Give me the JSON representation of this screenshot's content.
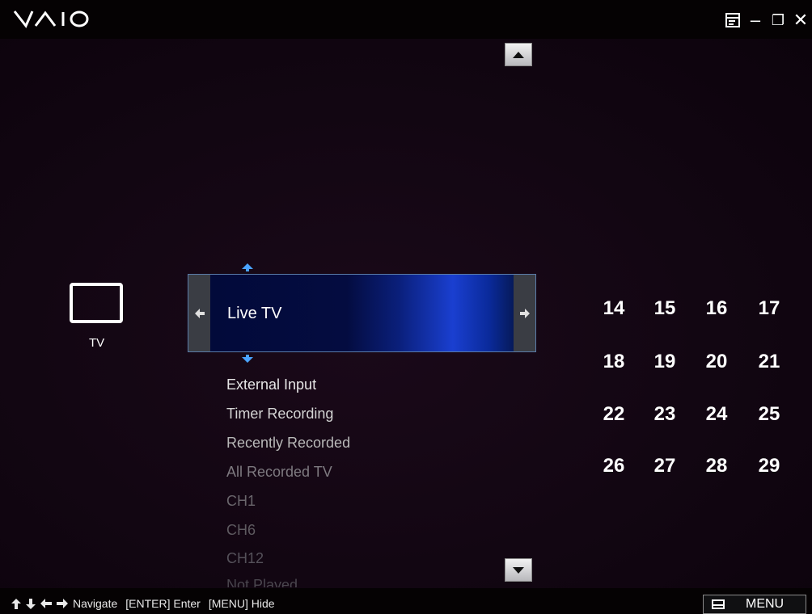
{
  "app": {
    "logo": "VAIO"
  },
  "window_controls": {
    "menu_icon": "window-menu-icon",
    "minimize_glyph": "–",
    "restore_glyph": "❐",
    "close_glyph": "✕"
  },
  "category": {
    "label": "TV",
    "icon": "tv-icon"
  },
  "selector": {
    "current": "Live TV"
  },
  "menu_items": [
    {
      "label": "External Input"
    },
    {
      "label": "Timer Recording"
    },
    {
      "label": "Recently Recorded"
    },
    {
      "label": "All Recorded TV"
    },
    {
      "label": "CH1"
    },
    {
      "label": "CH6"
    },
    {
      "label": "CH12"
    },
    {
      "label": "Not Played"
    }
  ],
  "calendar_rows": [
    [
      "14",
      "15",
      "16",
      "17"
    ],
    [
      "18",
      "19",
      "20",
      "21"
    ],
    [
      "22",
      "23",
      "24",
      "25"
    ],
    [
      "26",
      "27",
      "28",
      "29"
    ]
  ],
  "status": {
    "navigate": "Navigate",
    "enter": "[ENTER] Enter",
    "menu_hide": "[MENU] Hide",
    "menu_button": "MENU"
  },
  "colors": {
    "accent_arrow": "#4aa3ff",
    "background": "#120612",
    "selector_glow": "#1a3fd0"
  }
}
